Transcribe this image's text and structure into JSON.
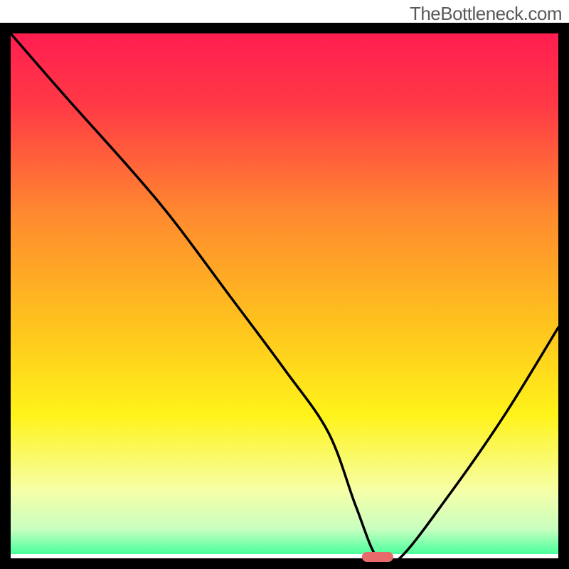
{
  "watermark": "TheBottleneck.com",
  "chart_data": {
    "type": "line",
    "title": "",
    "xlabel": "",
    "ylabel": "",
    "xlim": [
      0,
      100
    ],
    "ylim": [
      0,
      100
    ],
    "grid": false,
    "legend": false,
    "annotations": [],
    "background_gradient_stops": [
      {
        "pos": 0.0,
        "color": "#ff1a52"
      },
      {
        "pos": 0.15,
        "color": "#ff3a45"
      },
      {
        "pos": 0.35,
        "color": "#ff8a2f"
      },
      {
        "pos": 0.55,
        "color": "#ffc21e"
      },
      {
        "pos": 0.72,
        "color": "#fff31a"
      },
      {
        "pos": 0.86,
        "color": "#f6ffa8"
      },
      {
        "pos": 0.93,
        "color": "#c9ffc0"
      },
      {
        "pos": 0.975,
        "color": "#4dff9d"
      },
      {
        "pos": 1.0,
        "color": "#00e884"
      }
    ],
    "optimal_marker": {
      "x": 67,
      "y": 0,
      "color": "#e86a6a"
    },
    "series": [
      {
        "name": "bottleneck-curve",
        "x": [
          0,
          10,
          22,
          30,
          40,
          50,
          58,
          63,
          67,
          71,
          80,
          90,
          100
        ],
        "y": [
          100,
          88,
          74,
          64,
          50,
          36,
          24,
          10,
          0,
          0,
          12,
          27,
          44
        ]
      }
    ]
  }
}
